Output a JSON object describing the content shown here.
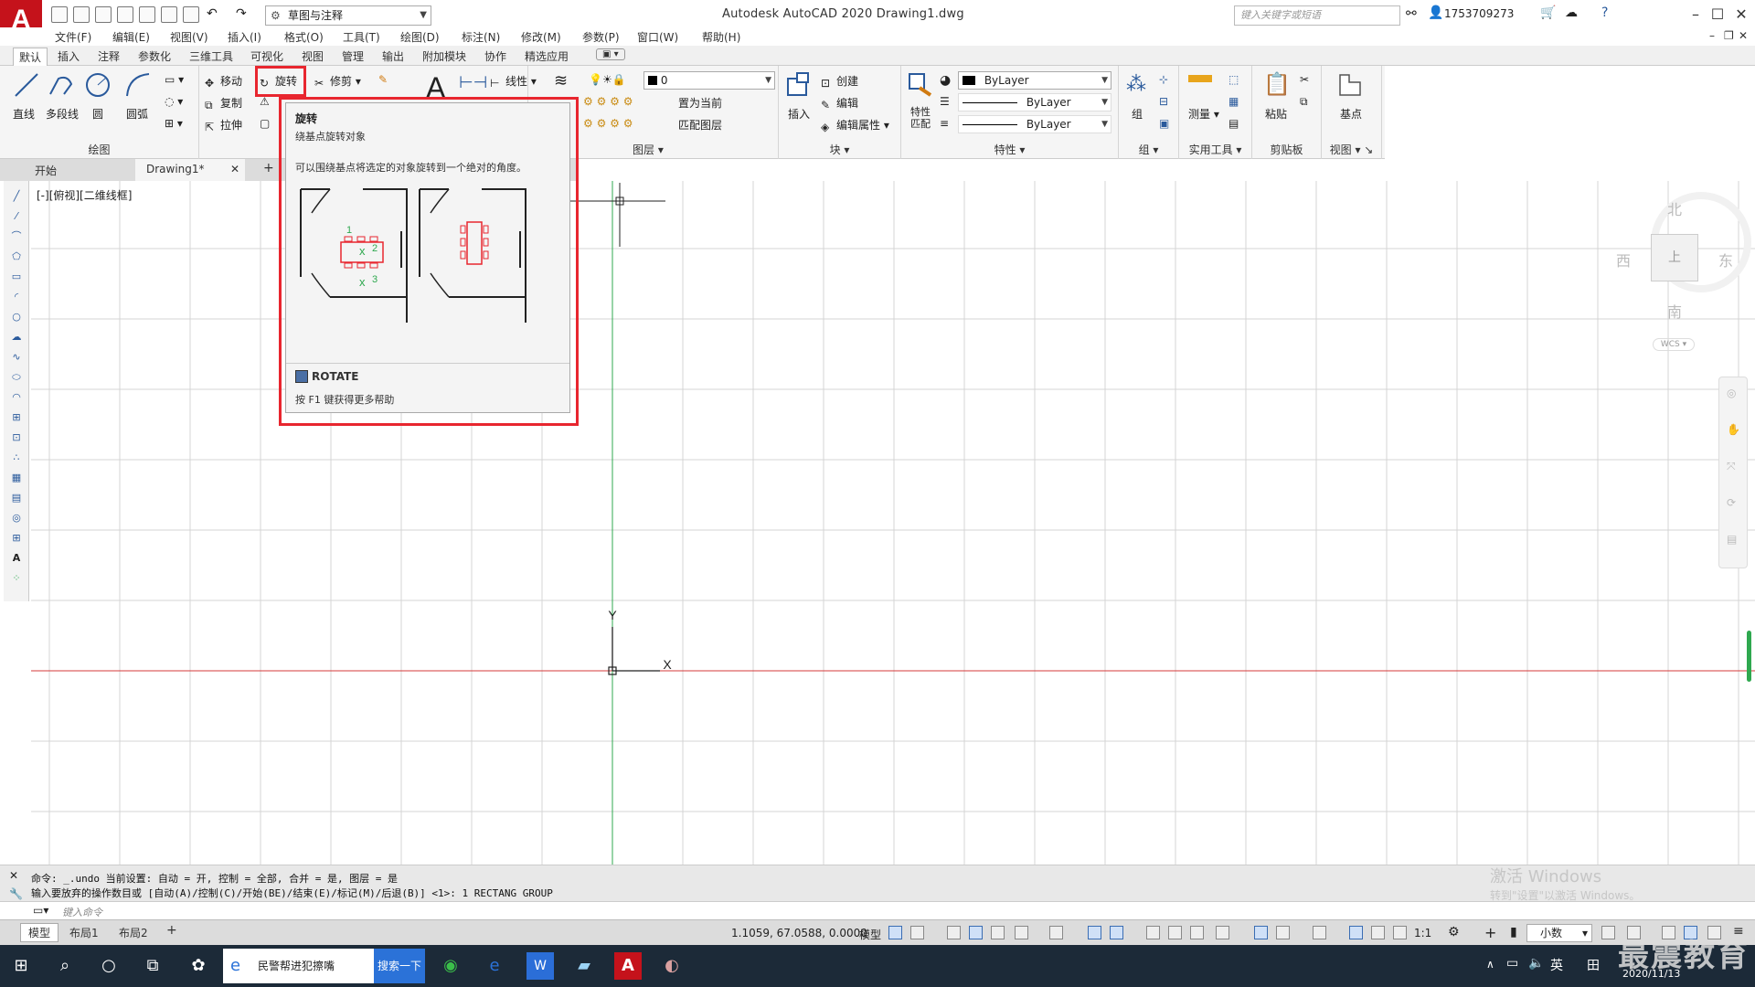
{
  "title_bar": {
    "workspace": "草图与注释",
    "title": "Autodesk AutoCAD 2020    Drawing1.dwg",
    "search_placeholder": "键入关键字或短语",
    "user": "1753709273"
  },
  "menu": [
    "文件(F)",
    "编辑(E)",
    "视图(V)",
    "插入(I)",
    "格式(O)",
    "工具(T)",
    "绘图(D)",
    "标注(N)",
    "修改(M)",
    "参数(P)",
    "窗口(W)",
    "帮助(H)"
  ],
  "ribbon_tabs": [
    "默认",
    "插入",
    "注释",
    "参数化",
    "三维工具",
    "可视化",
    "视图",
    "管理",
    "输出",
    "附加模块",
    "协作",
    "精选应用"
  ],
  "ribbon": {
    "draw": {
      "title": "绘图",
      "line": "直线",
      "polyline": "多段线",
      "circle": "圆",
      "arc": "圆弧"
    },
    "modify": {
      "move": "移动",
      "rotate": "旋转",
      "trim": "修剪",
      "copy": "复制",
      "stretch": "拉伸"
    },
    "annotation": {
      "linear": "线性"
    },
    "layers": {
      "title": "图层",
      "current_layer": "0",
      "set_current": "置为当前",
      "match_layer": "匹配图层"
    },
    "block": {
      "title": "块",
      "insert": "插入",
      "create": "创建",
      "edit": "编辑",
      "edit_attr": "编辑属性"
    },
    "properties": {
      "title": "特性",
      "match": "特性\n匹配",
      "color": "ByLayer",
      "linetype": "ByLayer",
      "lineweight": "ByLayer"
    },
    "groups": {
      "title": "组",
      "group": "组"
    },
    "utilities": {
      "title": "实用工具",
      "measure": "测量"
    },
    "clipboard": {
      "title": "剪贴板",
      "paste": "粘贴"
    },
    "view": {
      "title": "视图",
      "base": "基点"
    }
  },
  "file_tabs": {
    "start": "开始",
    "drawing": "Drawing1*"
  },
  "viewport_label": "[-][俯视][二维线框]",
  "tooltip": {
    "title": "旋转",
    "subtitle": "绕基点旋转对象",
    "description": "可以围绕基点将选定的对象旋转到一个绝对的角度。",
    "command": "ROTATE",
    "help": "按 F1 键获得更多帮助",
    "markers": [
      "1",
      "2",
      "3"
    ]
  },
  "viewcube": {
    "north": "北",
    "south": "南",
    "east": "东",
    "west": "西",
    "top": "上",
    "wcs": "WCS"
  },
  "axis": {
    "x": "X",
    "y": "Y"
  },
  "command_history": [
    "命令:  _.undo 当前设置: 自动 = 开, 控制 = 全部, 合并 = 是, 图层 = 是",
    "输入要放弃的操作数目或 [自动(A)/控制(C)/开始(BE)/结束(E)/标记(M)/后退(B)] <1>: 1 RECTANG GROUP"
  ],
  "command_placeholder": "键入命令",
  "layout_tabs": [
    "模型",
    "布局1",
    "布局2"
  ],
  "status": {
    "coords": "1.1059, 67.0588, 0.0000",
    "model": "模型",
    "scale": "1:1",
    "units": "小数"
  },
  "activate_windows": {
    "line1": "激活 Windows",
    "line2": "转到\"设置\"以激活 Windows。"
  },
  "taskbar": {
    "app": "民警帮进犯擦嘴",
    "search_button": "搜索一下",
    "ime": "英",
    "ime2": "田",
    "date": "2020/11/13"
  },
  "watermark": "最震教育",
  "colors": {
    "accent_red": "#e8262f",
    "autocad_red": "#c5121b",
    "grid": "#d4d4d4",
    "x_axis": "#d63a3a",
    "y_axis": "#2fa84f"
  }
}
